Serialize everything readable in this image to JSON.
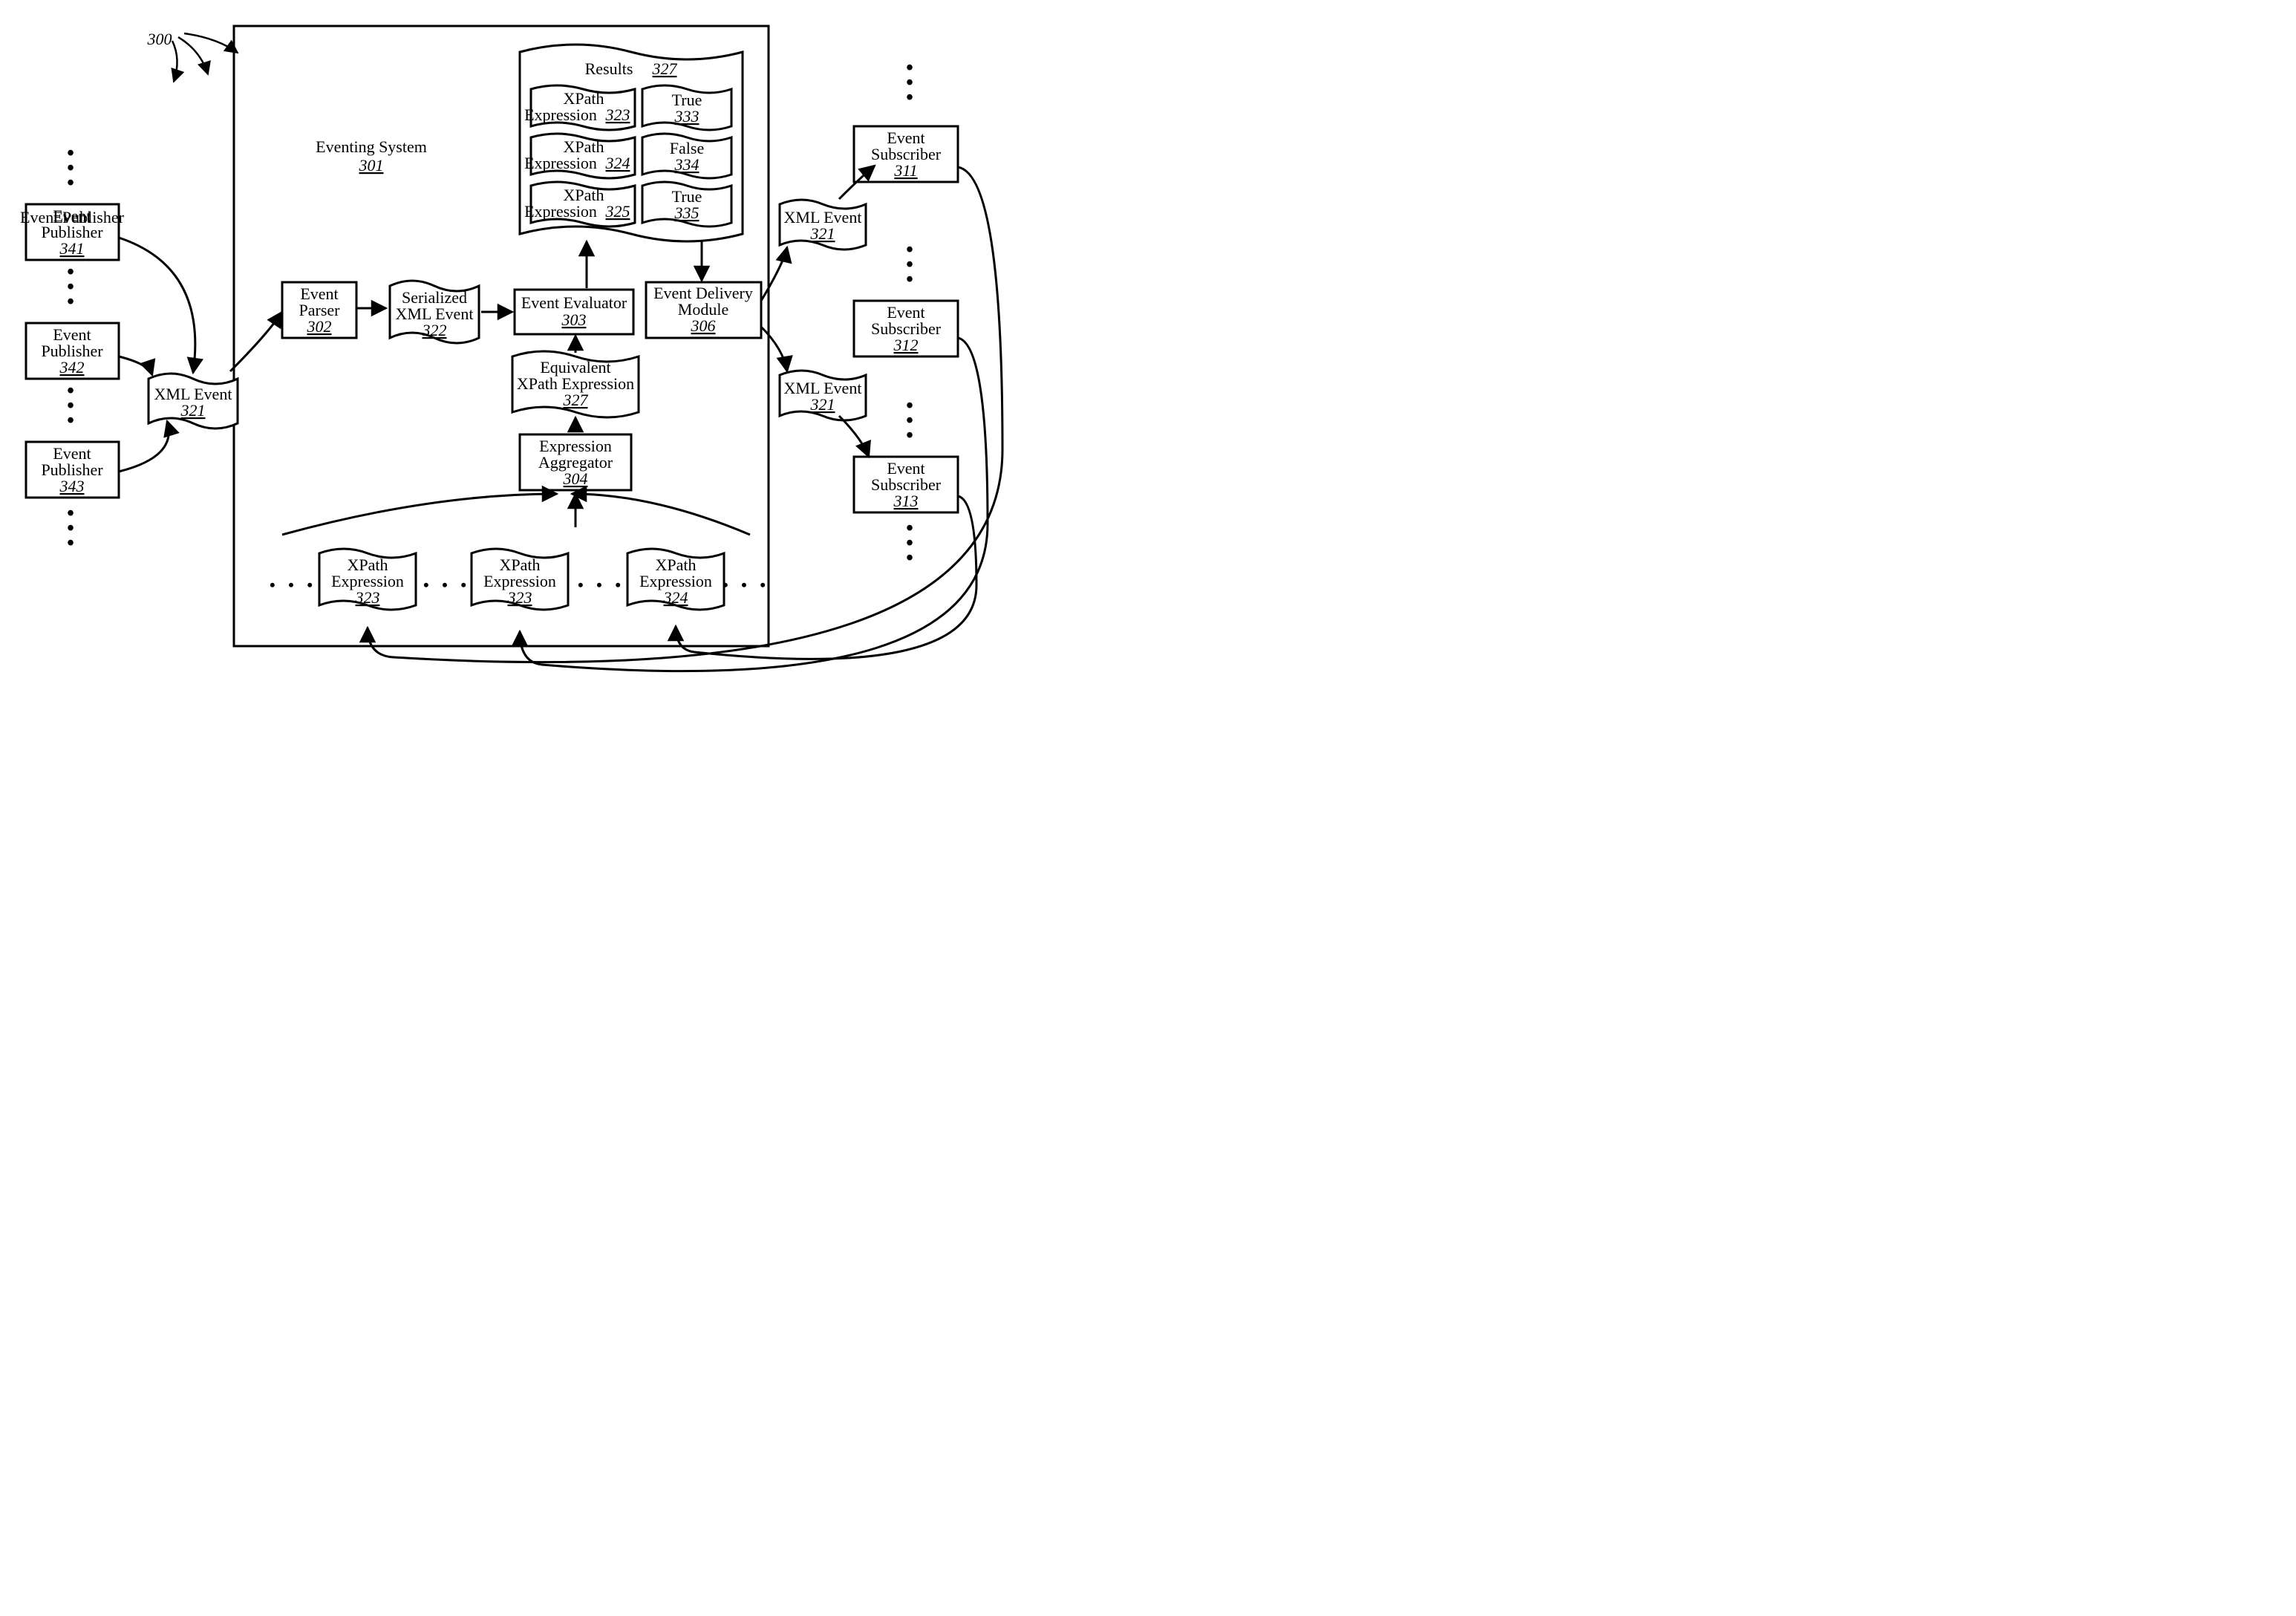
{
  "figure_ref": "300",
  "system": {
    "title": "Eventing System",
    "ref": "301"
  },
  "publishers": [
    {
      "name": "Event Publisher",
      "ref": "341"
    },
    {
      "name": "Event Publisher",
      "ref": "342"
    },
    {
      "name": "Event Publisher",
      "ref": "343"
    }
  ],
  "subscribers": [
    {
      "name": "Event Subscriber",
      "ref": "311"
    },
    {
      "name": "Event Subscriber",
      "ref": "312"
    },
    {
      "name": "Event Subscriber",
      "ref": "313"
    }
  ],
  "xml_event_left": {
    "name": "XML Event",
    "ref": "321"
  },
  "xml_event_right_a": {
    "name": "XML Event",
    "ref": "321"
  },
  "xml_event_right_b": {
    "name": "XML Event",
    "ref": "321"
  },
  "parser": {
    "name": "Event Parser",
    "ref": "302"
  },
  "serialized": {
    "name": "Serialized XML Event",
    "ref": "322"
  },
  "evaluator": {
    "name": "Event Evaluator",
    "ref": "303"
  },
  "delivery": {
    "name": "Event Delivery Module",
    "ref": "306"
  },
  "equiv": {
    "name": "Equivalent XPath Expression",
    "ref": "327"
  },
  "aggregator": {
    "name": "Expression Aggregator",
    "ref": "304"
  },
  "bottom_exprs": [
    {
      "name": "XPath Expression",
      "ref": "323"
    },
    {
      "name": "XPath Expression",
      "ref": "323"
    },
    {
      "name": "XPath Expression",
      "ref": "324"
    }
  ],
  "results": {
    "title": "Results",
    "ref": "327",
    "rows": [
      {
        "expr": "XPath Expression",
        "expr_ref": "323",
        "val": "True",
        "val_ref": "333"
      },
      {
        "expr": "XPath Expression",
        "expr_ref": "324",
        "val": "False",
        "val_ref": "334"
      },
      {
        "expr": "XPath Expression",
        "expr_ref": "325",
        "val": "True",
        "val_ref": "335"
      }
    ]
  }
}
